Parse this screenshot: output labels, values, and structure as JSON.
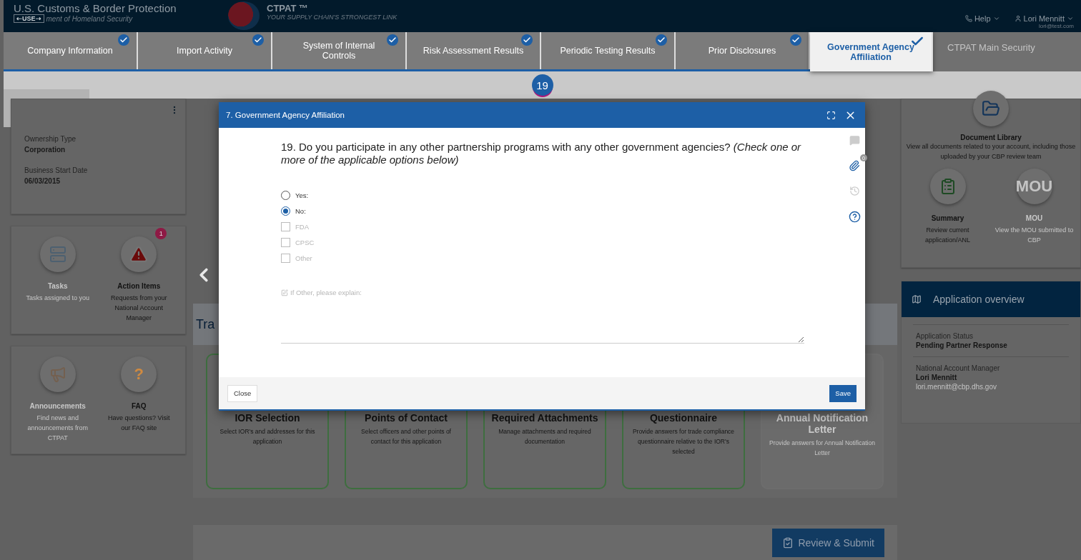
{
  "header": {
    "agency": "U.S. Customs & Border Protection",
    "use_control": "⇠USE⇢",
    "department": "ment of Homeland Security",
    "brand": "CTPAT ™",
    "tagline": "YOUR SUPPLY CHAIN'S STRONGEST LINK",
    "help": "Help",
    "user_name": "Lori Mennitt",
    "user_email": "lori@test.com"
  },
  "tabs": [
    {
      "label": "Company Information",
      "completed": true,
      "selected": false
    },
    {
      "label": "Import Activity",
      "completed": true,
      "selected": false
    },
    {
      "label": "System of Internal Controls",
      "completed": true,
      "selected": false
    },
    {
      "label": "Risk Assessment Results",
      "completed": true,
      "selected": false
    },
    {
      "label": "Periodic Testing Results",
      "completed": true,
      "selected": false
    },
    {
      "label": "Prior Disclosures",
      "completed": true,
      "selected": false
    },
    {
      "label": "Government Agency Affiliation",
      "completed": true,
      "selected": true
    }
  ],
  "faded_link": "CTPAT Main Security",
  "step_badge": "19",
  "profile": {
    "fields": [
      {
        "label": "Ownership Type",
        "value": "Corporation"
      },
      {
        "label": "Business Start Date",
        "value": "06/03/2015"
      }
    ]
  },
  "tile_groups": [
    [
      {
        "kind": "tasks",
        "title": "Tasks",
        "text": "Tasks assigned to you",
        "disabled": true
      },
      {
        "kind": "action",
        "title": "Action Items",
        "text": "Requests from your National Account Manager",
        "disabled": false,
        "badge": "1"
      }
    ],
    [
      {
        "kind": "announcements",
        "title": "Announcements",
        "text": "Find news and announcements from CTPAT",
        "disabled": true
      },
      {
        "kind": "faq",
        "icon_text": "?",
        "title": "FAQ",
        "text": "Have questions? Visit our FAQ site",
        "disabled": false
      }
    ]
  ],
  "section_title": "Tra",
  "steps": [
    {
      "title": "IOR Selection",
      "text": "Select IOR's and addresses for this application",
      "disabled": false
    },
    {
      "title": "Points of Contact",
      "text": "Select officers and other points of contact for this application",
      "disabled": false
    },
    {
      "title": "Required Attachments",
      "text": "Manage attachments and required documentation",
      "disabled": false
    },
    {
      "title": "Questionnaire",
      "text": "Provide answers for trade compliance questionnaire relative to the IOR's selected",
      "disabled": false
    },
    {
      "title": "Annual Notification Letter",
      "text": "Provide answers for Annual Notification Letter",
      "disabled": true
    }
  ],
  "review_button": "Review & Submit",
  "library": {
    "title": "Document Library",
    "text": "View all documents related to your account, including those uploaded by your CBP review team"
  },
  "library_tiles": [
    {
      "kind": "summary",
      "title": "Summary",
      "text": "Review current application/ANL",
      "disabled": false
    },
    {
      "kind": "mou",
      "icon_text": "MOU",
      "title": "MOU",
      "text": "View the MOU submitted to CBP",
      "disabled": true
    }
  ],
  "overview": {
    "title": "Application overview",
    "rows": [
      {
        "label": "Application Status",
        "value": "Pending Partner Response"
      },
      {
        "label": "National Account Manager",
        "value": "Lori Mennitt",
        "email": "lori.mennitt@cbp.dhs.gov"
      }
    ]
  },
  "modal": {
    "title": "7. Government Agency Affiliation",
    "question": "19. Do you participate in any other partnership programs with any other government agencies? *(Check one or more of the applicable options below)*",
    "attachments_count": "0",
    "options": [
      {
        "kind": "radio",
        "label": "Yes:",
        "selected": false,
        "disabled": false
      },
      {
        "kind": "radio",
        "label": "No:",
        "selected": true,
        "disabled": false
      },
      {
        "kind": "checkbox",
        "label": "FDA",
        "checked": false,
        "disabled": true
      },
      {
        "kind": "checkbox",
        "label": "CPSC",
        "checked": false,
        "disabled": true
      },
      {
        "kind": "checkbox",
        "label": "Other",
        "checked": false,
        "disabled": true
      }
    ],
    "explain_label": "If Other, please explain:",
    "close": "Close",
    "save": "Save"
  }
}
